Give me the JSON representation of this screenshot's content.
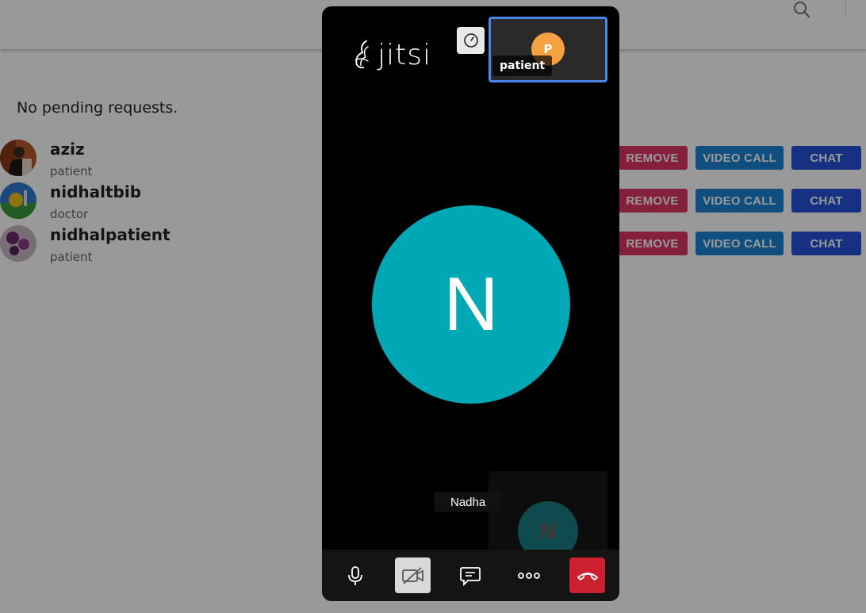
{
  "header": {
    "search_icon": "search-icon"
  },
  "requests": {
    "pending_text": "No pending requests."
  },
  "contacts": [
    {
      "name": "aziz",
      "role": "patient"
    },
    {
      "name": "nidhaltbib",
      "role": "doctor"
    },
    {
      "name": "nidhalpatient",
      "role": "patient"
    }
  ],
  "actions": {
    "remove_label": "REMOVE",
    "video_label": "VIDEO CALL",
    "chat_label": "CHAT"
  },
  "colors": {
    "remove": "#dc3565",
    "video": "#1a82d2",
    "chat": "#2652d8",
    "main_avatar": "#00a8b5",
    "thumb_avatar": "#f5a142",
    "hangup": "#cc1f2f"
  },
  "jitsi": {
    "logo_text": "jitsi",
    "remote_thumb": {
      "initial": "P",
      "label": "patient"
    },
    "main_initial": "N",
    "local_thumb": {
      "initial": "N",
      "label": "Nadha"
    },
    "toolbar": {
      "mic_icon": "microphone-icon",
      "camera_icon": "camera-off-icon",
      "chat_icon": "chat-icon",
      "more_icon": "more-icon",
      "hangup_icon": "hangup-icon"
    }
  }
}
